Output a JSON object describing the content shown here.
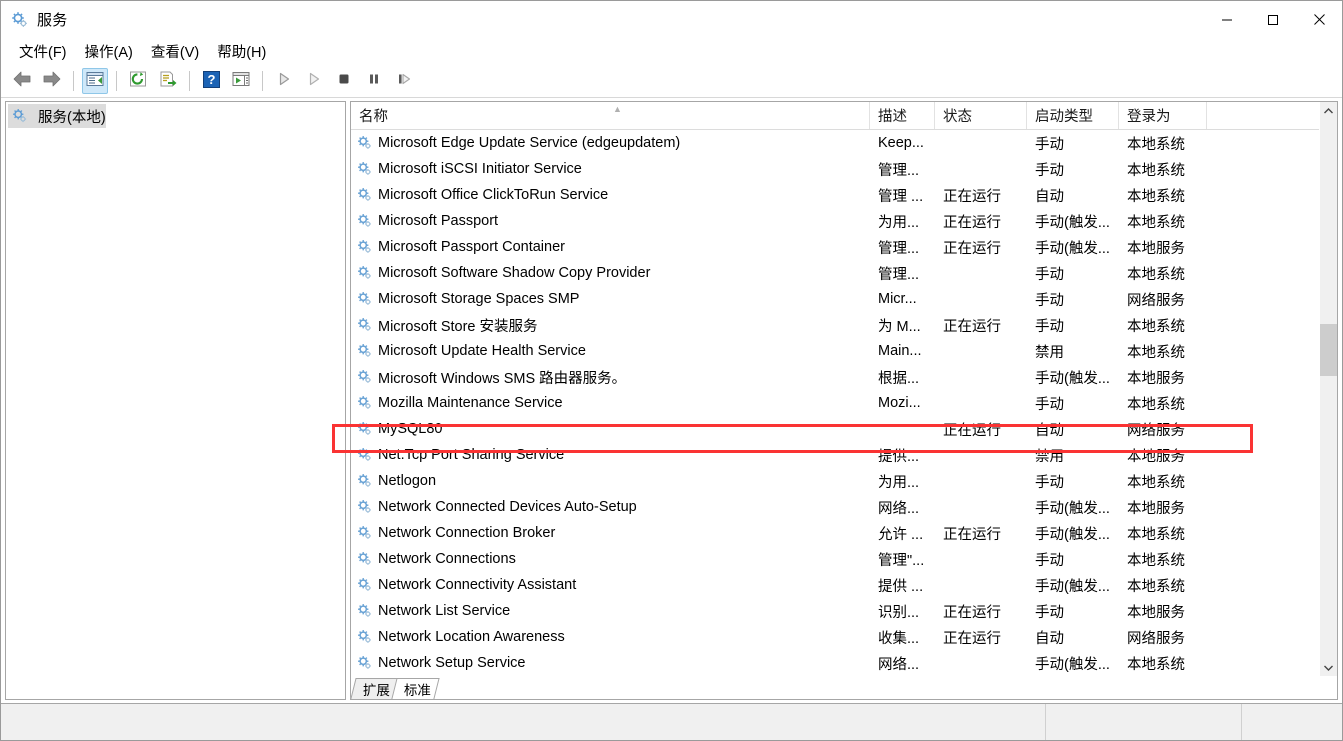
{
  "window": {
    "title": "服务",
    "title_icon": "services-gear-icon",
    "minimize_label": "最小化",
    "maximize_label": "最大化",
    "close_label": "关闭"
  },
  "menubar": {
    "items": [
      {
        "label": "文件(F)",
        "name": "menu-file"
      },
      {
        "label": "操作(A)",
        "name": "menu-action"
      },
      {
        "label": "查看(V)",
        "name": "menu-view"
      },
      {
        "label": "帮助(H)",
        "name": "menu-help"
      }
    ]
  },
  "toolbar": {
    "buttons": [
      {
        "icon": "back-arrow-icon",
        "name": "toolbar-back",
        "enabled": true
      },
      {
        "icon": "forward-arrow-icon",
        "name": "toolbar-forward",
        "enabled": true
      },
      {
        "icon": "show-hide-tree-icon",
        "name": "toolbar-show-hide-console-tree",
        "enabled": true,
        "selected": true
      },
      {
        "icon": "refresh-icon",
        "name": "toolbar-refresh",
        "enabled": true
      },
      {
        "icon": "export-list-icon",
        "name": "toolbar-export-list",
        "enabled": true
      },
      {
        "icon": "help-icon",
        "name": "toolbar-help",
        "enabled": true
      },
      {
        "icon": "show-action-pane-icon",
        "name": "toolbar-show-action-pane",
        "enabled": true
      },
      {
        "icon": "play-icon",
        "name": "toolbar-start-service",
        "enabled": false
      },
      {
        "icon": "play-outline-icon",
        "name": "toolbar-resume-service",
        "enabled": false
      },
      {
        "icon": "stop-icon",
        "name": "toolbar-stop-service",
        "enabled": false
      },
      {
        "icon": "pause-icon",
        "name": "toolbar-pause-service",
        "enabled": false
      },
      {
        "icon": "restart-icon",
        "name": "toolbar-restart-service",
        "enabled": false
      }
    ]
  },
  "tree": {
    "root_label": "服务(本地)",
    "root_icon": "services-gear-icon"
  },
  "list": {
    "columns": [
      {
        "label": "名称",
        "key": "name"
      },
      {
        "label": "描述",
        "key": "description"
      },
      {
        "label": "状态",
        "key": "status"
      },
      {
        "label": "启动类型",
        "key": "startup"
      },
      {
        "label": "登录为",
        "key": "logon"
      }
    ],
    "sort_indicator": "▲",
    "rows": [
      {
        "name": "Microsoft Edge Update Service (edgeupdatem)",
        "description": "Keep...",
        "status": "",
        "startup": "手动",
        "logon": "本地系统"
      },
      {
        "name": "Microsoft iSCSI Initiator Service",
        "description": "管理...",
        "status": "",
        "startup": "手动",
        "logon": "本地系统"
      },
      {
        "name": "Microsoft Office ClickToRun Service",
        "description": "管理 ...",
        "status": "正在运行",
        "startup": "自动",
        "logon": "本地系统"
      },
      {
        "name": "Microsoft Passport",
        "description": "为用...",
        "status": "正在运行",
        "startup": "手动(触发...",
        "logon": "本地系统"
      },
      {
        "name": "Microsoft Passport Container",
        "description": "管理...",
        "status": "正在运行",
        "startup": "手动(触发...",
        "logon": "本地服务"
      },
      {
        "name": "Microsoft Software Shadow Copy Provider",
        "description": "管理...",
        "status": "",
        "startup": "手动",
        "logon": "本地系统"
      },
      {
        "name": "Microsoft Storage Spaces SMP",
        "description": "Micr...",
        "status": "",
        "startup": "手动",
        "logon": "网络服务"
      },
      {
        "name": "Microsoft Store 安装服务",
        "description": "为 M...",
        "status": "正在运行",
        "startup": "手动",
        "logon": "本地系统"
      },
      {
        "name": "Microsoft Update Health Service",
        "description": "Main...",
        "status": "",
        "startup": "禁用",
        "logon": "本地系统"
      },
      {
        "name": "Microsoft Windows SMS 路由器服务。",
        "description": "根据...",
        "status": "",
        "startup": "手动(触发...",
        "logon": "本地服务"
      },
      {
        "name": "Mozilla Maintenance Service",
        "description": "Mozi...",
        "status": "",
        "startup": "手动",
        "logon": "本地系统"
      },
      {
        "name": "MySQL80",
        "description": "",
        "status": "正在运行",
        "startup": "自动",
        "logon": "网络服务",
        "highlighted": true
      },
      {
        "name": "Net.Tcp Port Sharing Service",
        "description": "提供...",
        "status": "",
        "startup": "禁用",
        "logon": "本地服务"
      },
      {
        "name": "Netlogon",
        "description": "为用...",
        "status": "",
        "startup": "手动",
        "logon": "本地系统"
      },
      {
        "name": "Network Connected Devices Auto-Setup",
        "description": "网络...",
        "status": "",
        "startup": "手动(触发...",
        "logon": "本地服务"
      },
      {
        "name": "Network Connection Broker",
        "description": "允许 ...",
        "status": "正在运行",
        "startup": "手动(触发...",
        "logon": "本地系统"
      },
      {
        "name": "Network Connections",
        "description": "管理\"...",
        "status": "",
        "startup": "手动",
        "logon": "本地系统"
      },
      {
        "name": "Network Connectivity Assistant",
        "description": "提供 ...",
        "status": "",
        "startup": "手动(触发...",
        "logon": "本地系统"
      },
      {
        "name": "Network List Service",
        "description": "识别...",
        "status": "正在运行",
        "startup": "手动",
        "logon": "本地服务"
      },
      {
        "name": "Network Location Awareness",
        "description": "收集...",
        "status": "正在运行",
        "startup": "自动",
        "logon": "网络服务"
      },
      {
        "name": "Network Setup Service",
        "description": "网络...",
        "status": "",
        "startup": "手动(触发...",
        "logon": "本地系统"
      }
    ]
  },
  "tabs": [
    {
      "label": "扩展",
      "name": "tab-extended",
      "active": false
    },
    {
      "label": "标准",
      "name": "tab-standard",
      "active": true
    }
  ],
  "statusbar": {
    "main_text": "",
    "panel2_text": "",
    "panel3_text": ""
  },
  "annotation": {
    "color": "#fa3333",
    "target": "MySQL80"
  },
  "scrollbar": {
    "up_arrow": "⌃",
    "down_arrow": "⌄"
  }
}
